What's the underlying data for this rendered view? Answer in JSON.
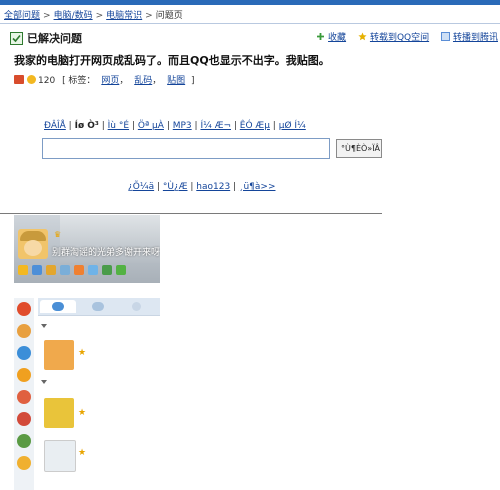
{
  "breadcrumb": {
    "items": [
      "全部问题",
      "电脑/数码",
      "电脑常识",
      "问题页"
    ],
    "sep": ">"
  },
  "status": {
    "title": "已解决问题",
    "actions": [
      {
        "label": "收藏",
        "icon": "plus-icon",
        "color": "#3a9a3a"
      },
      {
        "label": "转载到QQ空间",
        "icon": "star-icon",
        "color": "#e6b100"
      },
      {
        "label": "转播到腾讯",
        "icon": "share-icon",
        "color": "#5b8ed6"
      }
    ]
  },
  "question": {
    "title": "我家的电脑打开网页成乱码了。而且QQ也显示不出字。我贴图。",
    "reward": "120",
    "tags_label": "[ 标签：",
    "tags": [
      "网页",
      "乱码",
      "贴图"
    ],
    "tags_sep": "，",
    "tags_end": "]"
  },
  "screenshot": {
    "garbled_links": [
      "ÐÂÎÅ",
      "Íø Ò³",
      "Ìù °É",
      "Öª µÀ",
      "MP3",
      "Í¼ Æ¬",
      "ÊÓ Æµ",
      "µØ Í¼"
    ],
    "search_value": "",
    "search_button": "°Ù¶ÈÒ»ÏÂ",
    "bottom_links": [
      "¿Õ¼ä",
      "°Ù¿Æ",
      "hao123",
      "¸ü¶à>>"
    ],
    "bottom_sep": " | "
  },
  "qq": {
    "signature": "别群淘谣的光弟多谢开来呀",
    "toolbar_colors": [
      "#f3b821",
      "#4d8fd8",
      "#e3a62d",
      "#7aaed8",
      "#f08030",
      "#6fb3e8",
      "#4a9c4a",
      "#53b243"
    ],
    "sidebar_colors": [
      "#e04c2c",
      "#e8a040",
      "#3c8ed8",
      "#f0a020",
      "#e06040",
      "#d24a3a",
      "#5a9a44",
      "#f0b030"
    ],
    "buddy_colors": [
      "#f0a94c",
      "#e9c43a",
      "#e9eef2"
    ]
  }
}
